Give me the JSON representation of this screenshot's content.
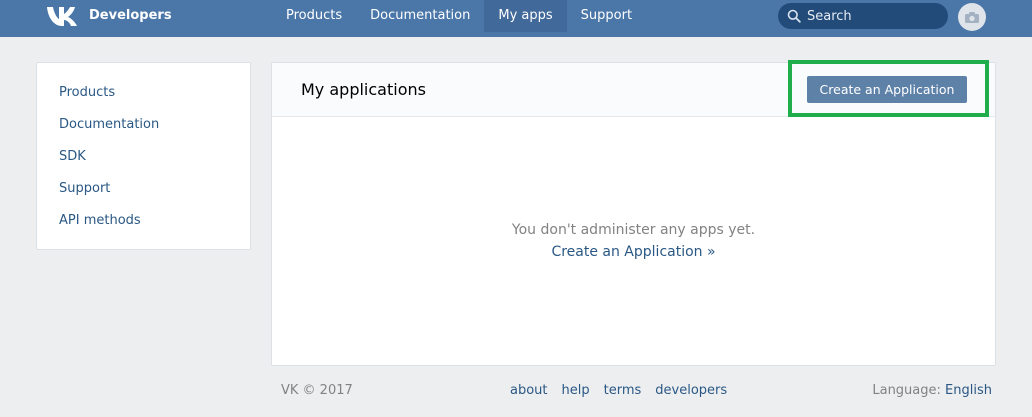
{
  "header": {
    "brand": "Developers",
    "logo_icon": "vk-logo-icon",
    "nav": [
      {
        "label": "Products",
        "active": false
      },
      {
        "label": "Documentation",
        "active": false
      },
      {
        "label": "My apps",
        "active": true
      },
      {
        "label": "Support",
        "active": false
      }
    ],
    "search": {
      "placeholder": "Search",
      "icon": "search-icon"
    },
    "avatar_icon": "camera-icon"
  },
  "sidebar": {
    "items": [
      {
        "label": "Products"
      },
      {
        "label": "Documentation"
      },
      {
        "label": "SDK"
      },
      {
        "label": "Support"
      },
      {
        "label": "API methods"
      }
    ]
  },
  "main": {
    "title": "My applications",
    "create_button": "Create an Application",
    "empty_text": "You don't administer any apps yet.",
    "empty_link": "Create an Application »"
  },
  "footer": {
    "copyright": "VK © 2017",
    "links": [
      {
        "label": "about"
      },
      {
        "label": "help"
      },
      {
        "label": "terms"
      },
      {
        "label": "developers"
      }
    ],
    "language_label": "Language:",
    "language_value": "English"
  },
  "colors": {
    "header_bg": "#4a76a8",
    "link": "#2a5885",
    "button_bg": "#5e81a8",
    "highlight": "#1fae4b",
    "page_bg": "#edeef0"
  }
}
